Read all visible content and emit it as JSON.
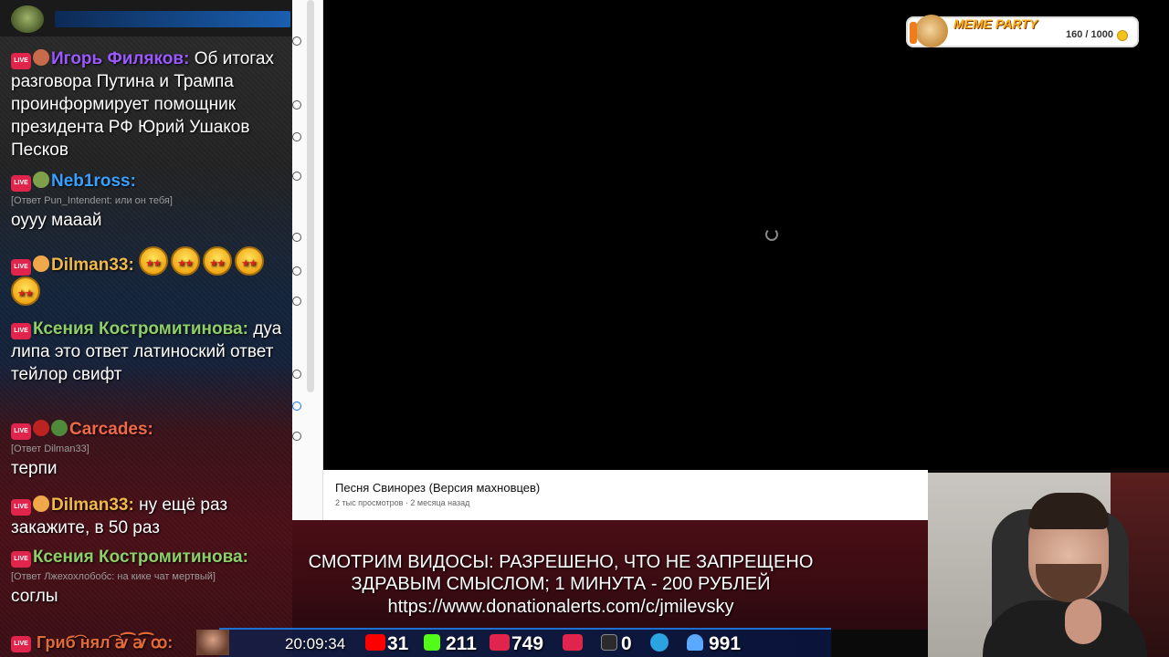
{
  "chat": {
    "messages": [
      {
        "user": "Игорь Филяков:",
        "color": "#9b59ff",
        "text": "Об итогах разговора Путина и Трампа проинформирует помощник президента РФ Юрий Ушаков  Песков"
      },
      {
        "user": "Neb1ross:",
        "color": "#3aa0ff",
        "reply": "[Ответ Pun_Intendent: или он тебя]",
        "text": "оууу мааай"
      },
      {
        "user": "Dilman33:",
        "color": "#f0b94a",
        "text": ""
      },
      {
        "user": "Ксения Костромитинова:",
        "color": "#8fcf6a",
        "text": "дуа липа это ответ латиноский ответ тейлор свифт"
      },
      {
        "user": "Carcades:",
        "color": "#f06a4a",
        "reply": "[Ответ Dilman33]",
        "text": "терпи"
      },
      {
        "user": "Dilman33:",
        "color": "#f0b94a",
        "text": "ну ещё раз закажите, в 50 раз"
      },
      {
        "user": "Ксения Костромитинова:",
        "color": "#8fcf6a",
        "reply": "[Ответ Лжехохлобобс: на кике чат мертвый]",
        "text": "соглы"
      }
    ],
    "bottom_user": "Гриб͡ нял͡ ꜹ͡ ꜹ͡ ꝏ:"
  },
  "video": {
    "title": "Песня Свинорез (Версия махновцев)",
    "views": "2 тыс просмотров",
    "date": "2 месяца назад"
  },
  "meme_party": {
    "title": "MEME PARTY",
    "count": "160 / 1000"
  },
  "banner": {
    "line1": "СМОТРИМ ВИДОСЫ: РАЗРЕШЕНО, ЧТО НЕ ЗАПРЕЩЕНО",
    "line2": "ЗДРАВЫМ СМЫСЛОМ; 1 МИНУТА - 200 РУБЛЕЙ",
    "line3": "https://www.donationalerts.com/c/jmilevsky"
  },
  "status": {
    "time": "20:09:34",
    "youtube": "31",
    "kick": "211",
    "vklive": "749",
    "rutube": "0",
    "viewers": "991",
    "colors": {
      "youtube": "#ff0000",
      "kick": "#53fc18",
      "vklive": "#e0244c",
      "rutube": "#2b2b2b",
      "telegram": "#2aa3e0",
      "viewers": "#5aa9ff"
    }
  }
}
